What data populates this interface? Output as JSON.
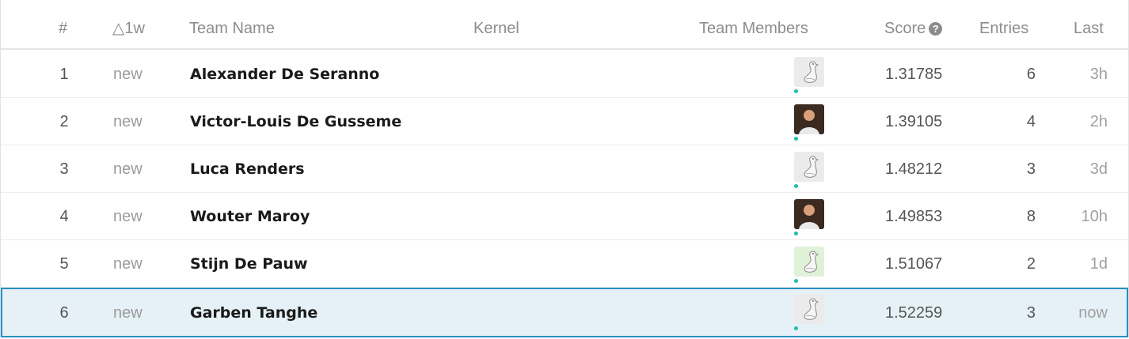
{
  "header": {
    "rank": "#",
    "delta": "△1w",
    "team_name": "Team Name",
    "kernel": "Kernel",
    "team_members": "Team Members",
    "score": "Score",
    "entries": "Entries",
    "last": "Last"
  },
  "rows": [
    {
      "rank": "1",
      "delta": "new",
      "team": "Alexander De Seranno",
      "avatar": "goose-avatar",
      "score": "1.31785",
      "entries": "6",
      "last": "3h"
    },
    {
      "rank": "2",
      "delta": "new",
      "team": "Victor-Louis De Gusseme",
      "avatar": "photo-avatar",
      "score": "1.39105",
      "entries": "4",
      "last": "2h"
    },
    {
      "rank": "3",
      "delta": "new",
      "team": "Luca Renders",
      "avatar": "goose-avatar",
      "score": "1.48212",
      "entries": "3",
      "last": "3d"
    },
    {
      "rank": "4",
      "delta": "new",
      "team": "Wouter Maroy",
      "avatar": "photo-avatar",
      "score": "1.49853",
      "entries": "8",
      "last": "10h"
    },
    {
      "rank": "5",
      "delta": "new",
      "team": "Stijn De Pauw",
      "avatar": "goose-avatar-green",
      "score": "1.51067",
      "entries": "2",
      "last": "1d"
    },
    {
      "rank": "6",
      "delta": "new",
      "team": "Garben Tanghe",
      "avatar": "goose-avatar",
      "score": "1.52259",
      "entries": "3",
      "last": "now"
    }
  ],
  "current_row_index": 5,
  "colors": {
    "highlight_bg": "#e6f1f7",
    "highlight_border": "#2b8fc2",
    "online_dot": "#20beaa"
  }
}
